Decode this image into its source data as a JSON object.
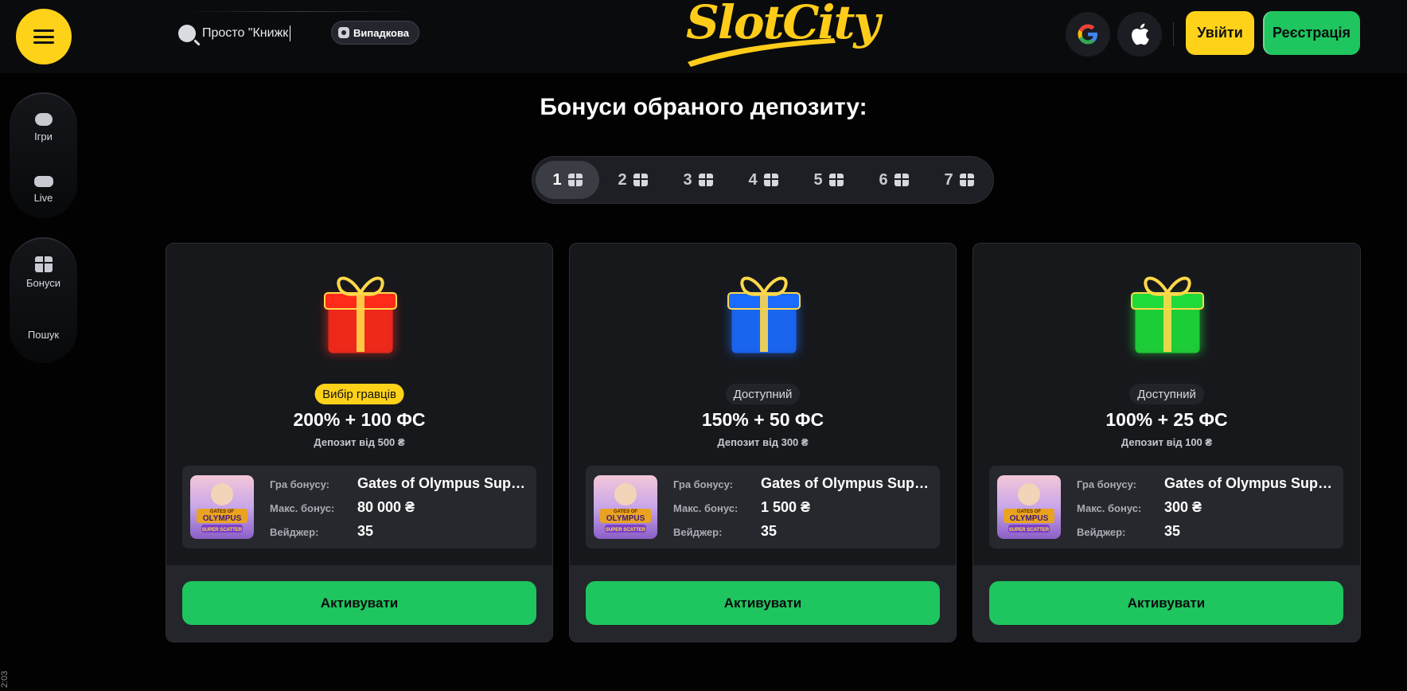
{
  "header": {
    "search_placeholder": "Просто \"Книжк",
    "random_label": "Випадкова",
    "logo_text": "SlotCity",
    "login_label": "Увійти",
    "register_label": "Реєстрація",
    "social": [
      "google-icon",
      "apple-icon"
    ]
  },
  "sidebar": {
    "groups": [
      {
        "items": [
          {
            "label": "Ігри",
            "icon": "gamepad-icon"
          },
          {
            "label": "Live",
            "icon": "live-icon"
          }
        ]
      },
      {
        "items": [
          {
            "label": "Бонуси",
            "icon": "gift-icon"
          },
          {
            "label": "Пошук",
            "icon": "search-icon"
          }
        ]
      }
    ],
    "timecode": "2:03"
  },
  "main": {
    "title": "Бонуси обраного депозиту:",
    "tabs": [
      {
        "label": "1",
        "active": true
      },
      {
        "label": "2"
      },
      {
        "label": "3"
      },
      {
        "label": "4"
      },
      {
        "label": "5"
      },
      {
        "label": "6"
      },
      {
        "label": "7"
      }
    ],
    "cards": [
      {
        "gift_color": "#ff2a1a",
        "badge": "Вибір гравців",
        "offer": "200% + 100 ФС",
        "deposit": "Депозит від 500 ₴",
        "labels": {
          "game": "Гра бонусу:",
          "max": "Макс. бонус:",
          "wager": "Вейджер:"
        },
        "game": "Gates of Olympus Super Scatter",
        "max_bonus": "80 000 ₴",
        "wager": "35",
        "button": "Активувати"
      },
      {
        "gift_color": "#1a6bff",
        "badge": "Доступний",
        "offer": "150% + 50 ФС",
        "deposit": "Депозит від 300 ₴",
        "labels": {
          "game": "Гра бонусу:",
          "max": "Макс. бонус:",
          "wager": "Вейджер:"
        },
        "game": "Gates of Olympus Super Scatter",
        "max_bonus": "1 500 ₴",
        "wager": "35",
        "button": "Активувати"
      },
      {
        "gift_color": "#1edb3a",
        "badge": "Доступний",
        "offer": "100% + 25 ФС",
        "deposit": "Депозит від 100 ₴",
        "labels": {
          "game": "Гра бонусу:",
          "max": "Макс. бонус:",
          "wager": "Вейджер:"
        },
        "game": "Gates of Olympus Super Scatter",
        "max_bonus": "300 ₴",
        "wager": "35",
        "button": "Активувати"
      }
    ],
    "thumb_text": [
      "GATES OF",
      "OLYMPUS",
      "SUPER SCATTER"
    ]
  }
}
